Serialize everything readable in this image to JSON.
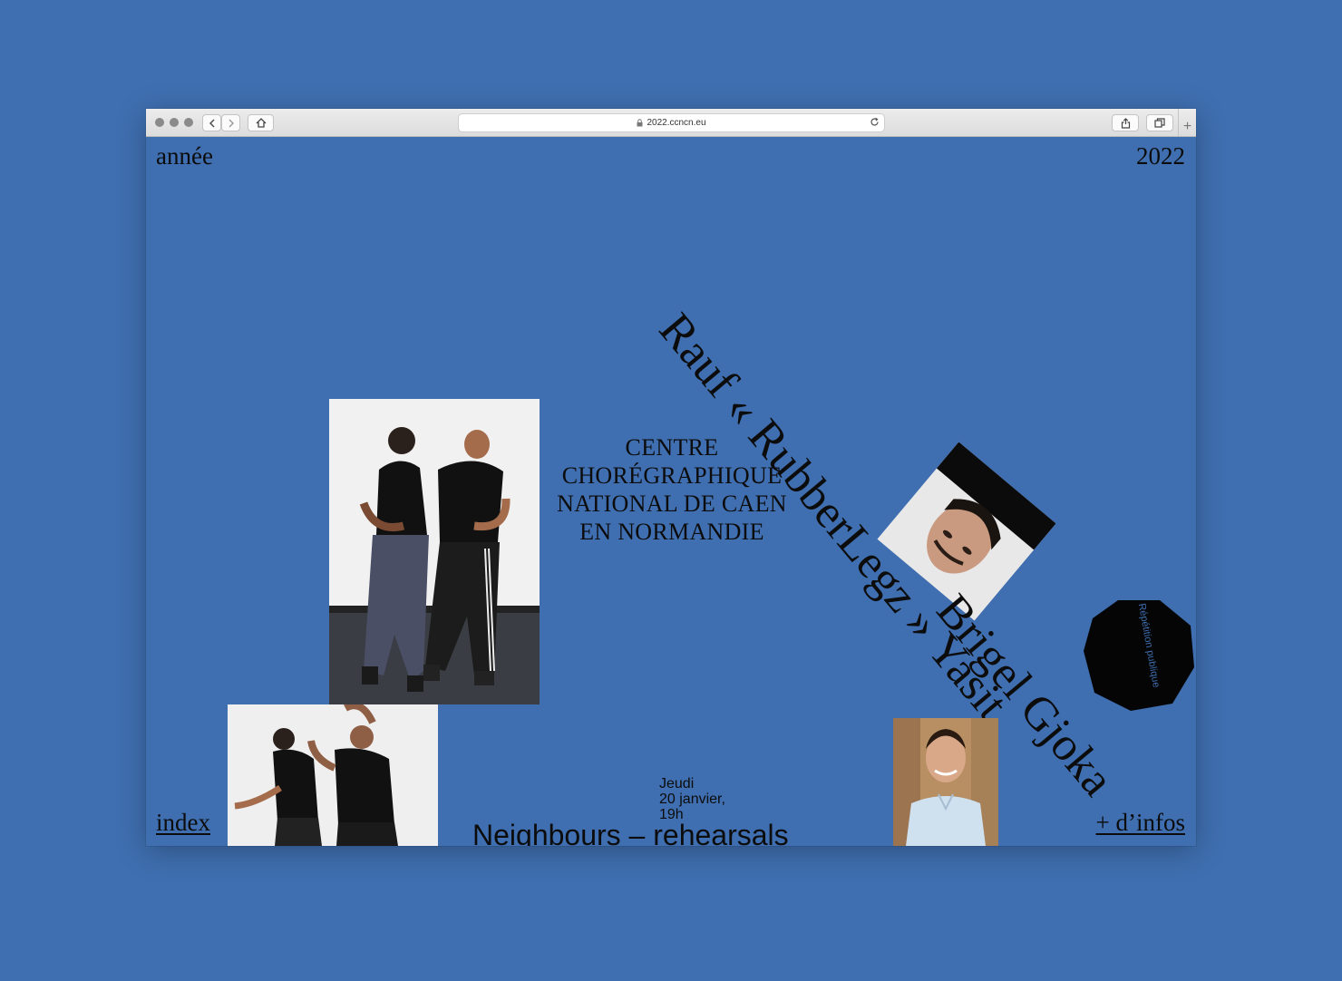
{
  "browser": {
    "url": "2022.ccncn.eu"
  },
  "header": {
    "left_label": "année",
    "right_label": "2022"
  },
  "institution": {
    "lines": [
      "CENTRE",
      "CHORÉGRAPHIQUE",
      "NATIONAL DE CAEN",
      "EN NORMANDIE"
    ]
  },
  "artist": {
    "name_line": "Rauf « RubberLegz » Yasit",
    "part1": "Rauf",
    "part2": "« RubberLegz »",
    "part3": "Yasit",
    "second_name": "Brigel Gjoka"
  },
  "badge": {
    "label": "Répétition publique"
  },
  "event": {
    "day": "Jeudi",
    "date": "20 janvier,",
    "time": "19h",
    "title": "Neighbours – rehearsals"
  },
  "footer": {
    "index_label": "index",
    "info_label": "+ d’infos"
  },
  "icons": [
    "back-icon",
    "forward-icon",
    "home-icon",
    "lock-icon",
    "reload-icon",
    "share-icon",
    "tabs-icon",
    "new-tab-icon"
  ],
  "colors": {
    "background": "#3f6fb0",
    "text": "#0c0c0c"
  }
}
